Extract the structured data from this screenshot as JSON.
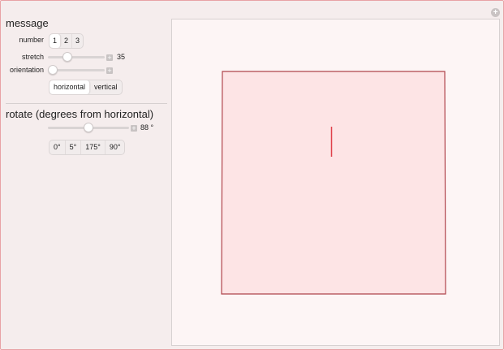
{
  "controls": {
    "message_title": "message",
    "number_label": "number",
    "number_options": [
      "1",
      "2",
      "3"
    ],
    "stretch_label": "stretch",
    "stretch_value": "35",
    "stretch_fraction": 0.3,
    "orientation_label": "orientation",
    "orientation_fraction": 0.0,
    "orientation_options": [
      "horizontal",
      "vertical"
    ],
    "rotate_title": "rotate (degrees from horizontal)",
    "rotate_value": "88 °",
    "rotate_fraction": 0.49,
    "rotate_options": [
      "0°",
      "5°",
      "175°",
      "90°"
    ]
  },
  "colors": {
    "frame_border": "#e8a3a6",
    "square_fill": "#fde4e5",
    "square_stroke": "#b0444c",
    "line_color": "#e0404a"
  },
  "icons": {
    "corner": "plus-circle-icon",
    "stepper": "plus-icon"
  }
}
